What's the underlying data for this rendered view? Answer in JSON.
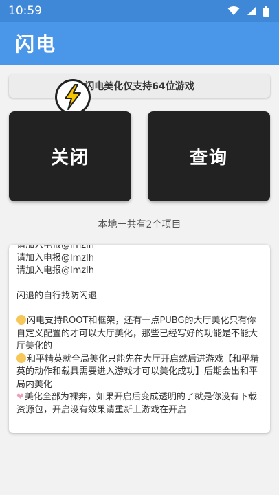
{
  "status_bar": {
    "time": "10:59",
    "icons": [
      "wifi-icon",
      "signal-icon",
      "battery-icon"
    ]
  },
  "app_bar": {
    "title": "闪电"
  },
  "notice": {
    "text": "闪电美化仅支持64位游戏"
  },
  "buttons": {
    "close_label": "关闭",
    "query_label": "查询"
  },
  "project_count": "本地一共有2个项目",
  "panel": {
    "line_top_partial": "请加入电报@lmzlh",
    "line_join_1": "请加入电报@lmzlh",
    "line_join_2": "请加入电报@lmzlh",
    "line_flash_exit": "闪退的自行找防闪退",
    "para_1": "闪电支持ROOT和框架，还有一点PUBG的大厅美化只有你自定义配置的才可以大厅美化，那些已经写好的功能是不能大厅美化的",
    "para_2": "和平精英就全局美化只能先在大厅开启然后进游戏【和平精英的动作和载具需要进入游戏才可以美化成功】后期会出和平局内美化",
    "para_3": "美化全部为裸奔，如果开启后变成透明的了就是你没有下载资源包，开启没有效果请重新上游戏在开启"
  },
  "colors": {
    "status_bar": "#3f88d8",
    "app_bar": "#4a96e8",
    "button": "#222222"
  }
}
